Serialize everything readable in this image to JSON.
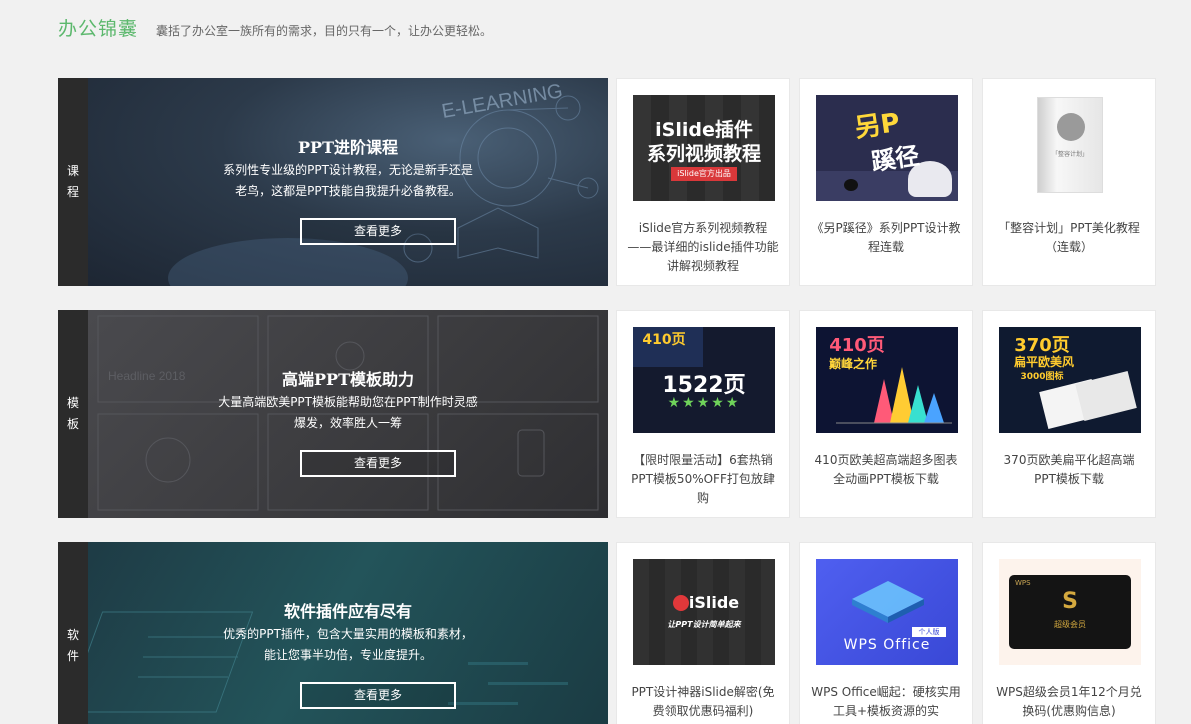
{
  "header": {
    "title": "办公锦囊",
    "desc": "囊括了办公室一族所有的需求，目的只有一个，让办公更轻松。"
  },
  "sections": [
    {
      "side": [
        "课",
        "程"
      ],
      "heading": "PPT进阶课程",
      "text": "系列性专业级的PPT设计教程，无论是新手还是老鸟，这都是PPT技能自我提升必备教程。",
      "more": "查看更多",
      "bg_text": "E-LEARNING",
      "cards": [
        {
          "caption": "iSlide官方系列视频教程——最详细的islide插件功能讲解视频教程",
          "thumb_title": "iSlide插件",
          "thumb_sub": "系列视频教程",
          "thumb_badge": "iSlide官方出品"
        },
        {
          "caption": "《另P蹊径》系列PPT设计教程连载",
          "thumb_title": "另P",
          "thumb_sub": "蹊径"
        },
        {
          "caption": "「整容计划」PPT美化教程（连载）",
          "thumb_title": "「整容计划」"
        }
      ]
    },
    {
      "side": [
        "模",
        "板"
      ],
      "heading": "高端PPT模板助力",
      "text": "大量高端欧美PPT模板能帮助您在PPT制作时灵感爆发，效率胜人一筹",
      "more": "查看更多",
      "bg_text": "Headline 2018",
      "cards": [
        {
          "caption": "【限时限量活动】6套热销PPT模板50%OFF打包放肆购",
          "thumb_title": "410页",
          "thumb_sub": "1522页",
          "thumb_badge": "★★★★★"
        },
        {
          "caption": "410页欧美超高端超多图表全动画PPT模板下载",
          "thumb_title": "410页",
          "thumb_sub": "巅峰之作"
        },
        {
          "caption": "370页欧美扁平化超高端PPT模板下载",
          "thumb_title": "370页",
          "thumb_sub": "扁平欧美风",
          "thumb_badge": "3000图标"
        }
      ]
    },
    {
      "side": [
        "软",
        "件"
      ],
      "heading": "软件插件应有尽有",
      "text": "优秀的PPT插件，包含大量实用的模板和素材，能让您事半功倍，专业度提升。",
      "more": "查看更多",
      "cards": [
        {
          "caption": "PPT设计神器iSlide解密(免费领取优惠码福利)",
          "thumb_title": "iSlide",
          "thumb_sub": "让PPT设计简单起来"
        },
        {
          "caption": "WPS Office崛起：硬核实用工具+模板资源的实",
          "thumb_title": "WPS Office",
          "thumb_badge": "个人版"
        },
        {
          "caption": "WPS超级会员1年12个月兑换码(优惠购信息)",
          "thumb_title": "S",
          "thumb_sub": "超级会员",
          "thumb_badge": "WPS"
        }
      ]
    }
  ],
  "colors": {
    "accent": "#5cb86d",
    "side_bar": "#2b2b2b",
    "page_bg": "#f1f1f1"
  }
}
